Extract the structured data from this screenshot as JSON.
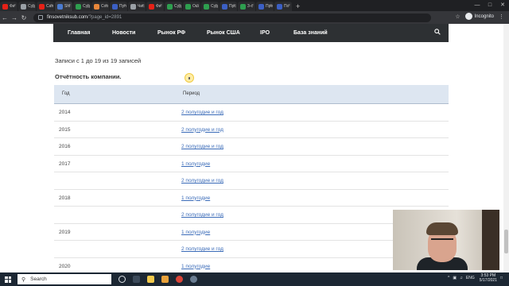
{
  "browser": {
    "tabs": [
      {
        "label": "Фи",
        "favicon_color": "#e62117"
      },
      {
        "label": "Суд",
        "favicon_color": "#9aa0a6"
      },
      {
        "label": "Сап",
        "favicon_color": "#e62117"
      },
      {
        "label": "Shi",
        "favicon_color": "#4a7bd0"
      },
      {
        "label": "Суд",
        "favicon_color": "#2e9e4f"
      },
      {
        "label": "Соо",
        "favicon_color": "#e8873a"
      },
      {
        "label": "Пуп",
        "favicon_color": "#3b5fc4"
      },
      {
        "label": "Чис",
        "favicon_color": "#9aa0a6"
      },
      {
        "label": "Фи",
        "favicon_color": "#e62117"
      },
      {
        "label": "Суд",
        "favicon_color": "#2e9e4f"
      },
      {
        "label": "Ош",
        "favicon_color": "#2e9e4f"
      },
      {
        "label": "Суд",
        "favicon_color": "#2e9e4f"
      },
      {
        "label": "Прс",
        "favicon_color": "#3b5fc4"
      },
      {
        "label": "3-с",
        "favicon_color": "#2e9e4f"
      },
      {
        "label": "Пре",
        "favicon_color": "#3b5fc4"
      },
      {
        "label": "По",
        "favicon_color": "#3b5fc4"
      }
    ],
    "new_tab": "+",
    "url_host": "finsovetniksub.com",
    "url_path": "/?page_id=2891",
    "incognito_label": "Incognito"
  },
  "site_nav": {
    "items": [
      "Главная",
      "Новости",
      "Рынок РФ",
      "Рынок США",
      "IPO",
      "База знаний"
    ],
    "search_icon": "search-icon"
  },
  "records_info": "Записи с 1 до 19 из 19 записей",
  "report_title": "Отчётность компании.",
  "table": {
    "headers": [
      "Год",
      "Период"
    ],
    "rows": [
      {
        "year": "2014",
        "period": "2 полугодие и год"
      },
      {
        "year": "2015",
        "period": "2 полугодие и год"
      },
      {
        "year": "2016",
        "period": "2 полугодие и год"
      },
      {
        "year": "2017",
        "period": "1 полугодие"
      },
      {
        "year": "",
        "period": "2 полугодие и год"
      },
      {
        "year": "2018",
        "period": "1 полугодие"
      },
      {
        "year": "",
        "period": "2 полугодие и год"
      },
      {
        "year": "2019",
        "period": "1 полугодие"
      },
      {
        "year": "",
        "period": "2 полугодие и год"
      },
      {
        "year": "2020",
        "period": "1 полугодие"
      }
    ]
  },
  "taskbar": {
    "search_label": "Search",
    "lang": "ENG",
    "time": "3:53 PM",
    "date": "5/17/2021"
  }
}
